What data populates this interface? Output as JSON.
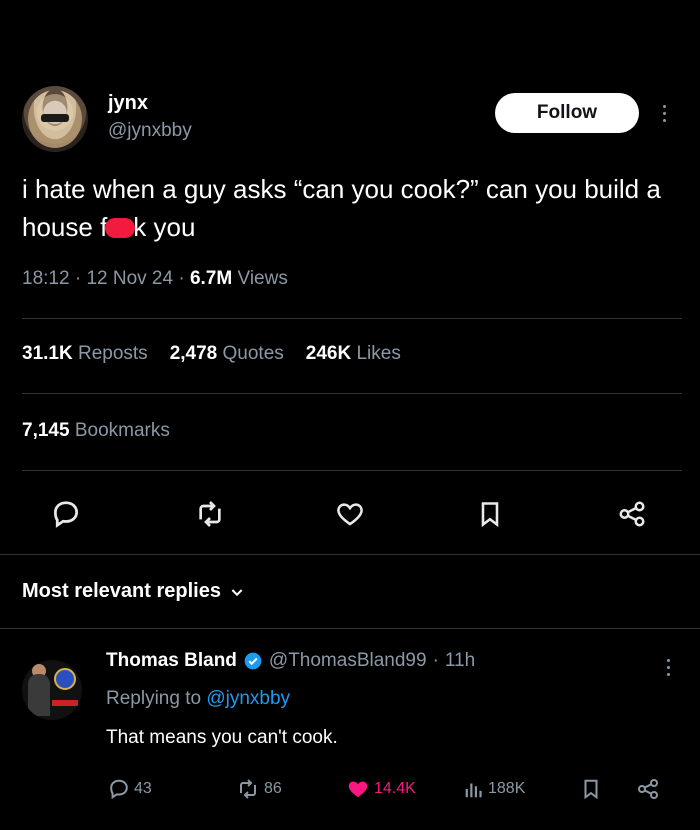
{
  "tweet": {
    "display_name": "jynx",
    "handle": "@jynxbby",
    "follow_label": "Follow",
    "text_part1": "i hate when a guy asks “can you cook?” can you build a house f",
    "text_part2": "k you",
    "time": "18:12",
    "date": "12 Nov 24",
    "views_count": "6.7M",
    "views_label": "Views",
    "reposts_count": "31.1K",
    "reposts_label": "Reposts",
    "quotes_count": "2,478",
    "quotes_label": "Quotes",
    "likes_count": "246K",
    "likes_label": "Likes",
    "bookmarks_count": "7,145",
    "bookmarks_label": "Bookmarks"
  },
  "sort": {
    "label": "Most relevant replies"
  },
  "reply": {
    "display_name": "Thomas Bland",
    "handle": "@ThomasBland99",
    "time": "11h",
    "replying_prefix": "Replying to",
    "replying_to": "@jynxbby",
    "text": "That means you can't cook.",
    "replies": "43",
    "reposts": "86",
    "likes": "14.4K",
    "views": "188K"
  },
  "colors": {
    "background": "#000000",
    "secondary_text": "#8b98a5",
    "link": "#1d9bf0",
    "like": "#f91880",
    "censor": "#f21b3f"
  },
  "icons": [
    "more-icon",
    "reply-icon",
    "repost-icon",
    "like-icon",
    "bookmark-icon",
    "share-icon",
    "chevron-down-icon",
    "verified-icon",
    "views-icon"
  ]
}
